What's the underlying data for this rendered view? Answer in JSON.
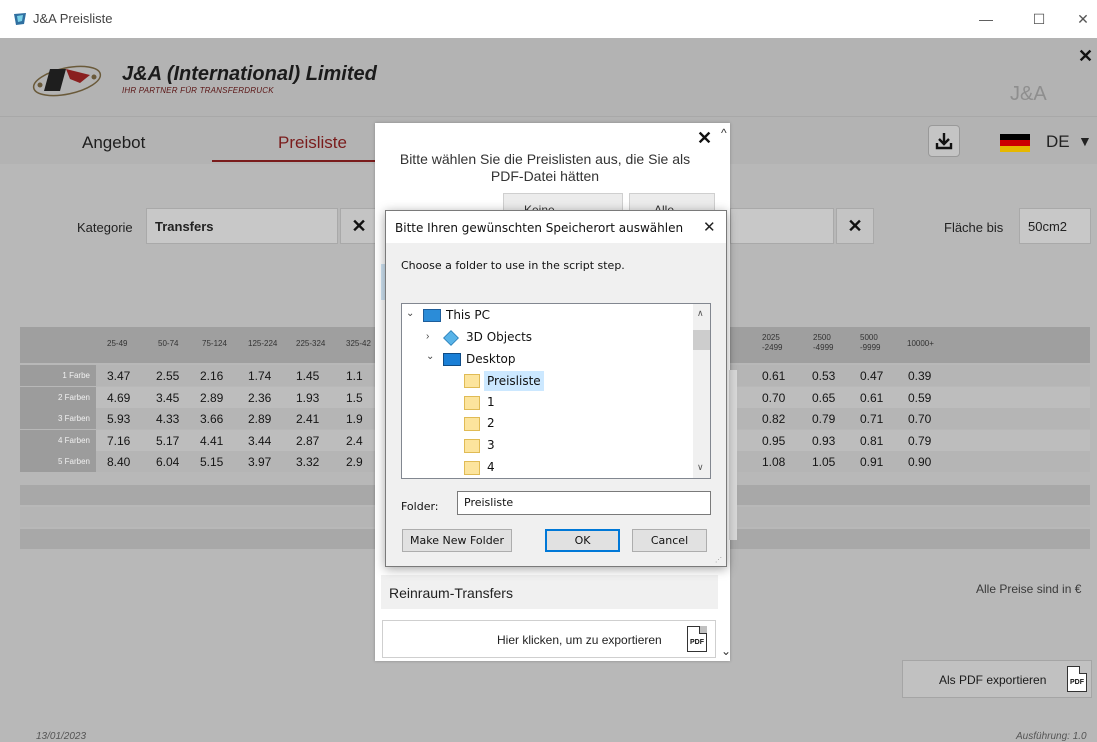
{
  "window": {
    "title": "J&A Preisliste",
    "minimize": "—",
    "maximize": "☐",
    "close": "✕"
  },
  "header": {
    "company": "J&A (International) Limited",
    "slogan": "IHR PARTNER FÜR TRANSFERDRUCK",
    "brand_short": "J&A",
    "close": "✕"
  },
  "tabs": [
    {
      "label": "Angebot"
    },
    {
      "label": "Preisliste"
    }
  ],
  "toolbar": {
    "download_icon": "download-icon",
    "language": "DE",
    "caret": "▼"
  },
  "filters": {
    "category_label": "Kategorie",
    "category_value": "Transfers",
    "clear": "✕",
    "area_label": "Fläche bis",
    "area_value": "50cm2"
  },
  "table": {
    "headers": [
      "25-49",
      "50-74",
      "75-124",
      "125-224",
      "225-324",
      "325-42"
    ],
    "right_headers": [
      {
        "l1": "2025",
        "l2": "-2499"
      },
      {
        "l1": "2500",
        "l2": "-4999"
      },
      {
        "l1": "5000",
        "l2": "-9999"
      },
      {
        "l1": "10000+",
        "l2": ""
      }
    ],
    "rows": [
      {
        "label": "1 Farbe",
        "left": [
          "3.47",
          "2.55",
          "2.16",
          "1.74",
          "1.45",
          "1.1"
        ],
        "right": [
          "0.61",
          "0.53",
          "0.47",
          "0.39"
        ]
      },
      {
        "label": "2 Farben",
        "left": [
          "4.69",
          "3.45",
          "2.89",
          "2.36",
          "1.93",
          "1.5"
        ],
        "right": [
          "0.70",
          "0.65",
          "0.61",
          "0.59"
        ]
      },
      {
        "label": "3 Farben",
        "left": [
          "5.93",
          "4.33",
          "3.66",
          "2.89",
          "2.41",
          "1.9"
        ],
        "right": [
          "0.82",
          "0.79",
          "0.71",
          "0.70"
        ]
      },
      {
        "label": "4 Farben",
        "left": [
          "7.16",
          "5.17",
          "4.41",
          "3.44",
          "2.87",
          "2.4"
        ],
        "right": [
          "0.95",
          "0.93",
          "0.81",
          "0.79"
        ]
      },
      {
        "label": "5 Farben",
        "left": [
          "8.40",
          "6.04",
          "5.15",
          "3.97",
          "3.32",
          "2.9"
        ],
        "right": [
          "1.08",
          "1.05",
          "0.91",
          "0.90"
        ]
      }
    ]
  },
  "note": "Alle Preise sind in €",
  "export_main": {
    "label": "Als PDF exportieren",
    "pdf": "PDF"
  },
  "footer": {
    "date": "13/01/2023",
    "version": "Ausführung: 1.0"
  },
  "panel": {
    "heading_line1": "Bitte wählen Sie die Preislisten aus, die Sie als",
    "heading_line2": "PDF-Datei hätten",
    "btn_none": "Keine",
    "btn_all": "Alle",
    "close": "✕",
    "scroll_up": "^",
    "scroll_down": "⌄",
    "item": "Reinraum-Transfers",
    "export_label": "Hier klicken, um zu exportieren",
    "pdf": "PDF"
  },
  "dialog": {
    "title": "Bitte Ihren gewünschten Speicherort auswählen",
    "close": "✕",
    "message": "Choose a folder to use in the script step.",
    "tree": [
      {
        "label": "This PC",
        "twisty": "⌄"
      },
      {
        "label": "3D Objects",
        "twisty": "›"
      },
      {
        "label": "Desktop",
        "twisty": "⌄"
      },
      {
        "label": "Preisliste",
        "twisty": ""
      },
      {
        "label": "1",
        "twisty": ""
      },
      {
        "label": "2",
        "twisty": ""
      },
      {
        "label": "3",
        "twisty": ""
      },
      {
        "label": "4",
        "twisty": ""
      }
    ],
    "folder_label": "Folder:",
    "folder_value": "Preisliste",
    "btn_new": "Make New Folder",
    "btn_ok": "OK",
    "btn_cancel": "Cancel"
  }
}
